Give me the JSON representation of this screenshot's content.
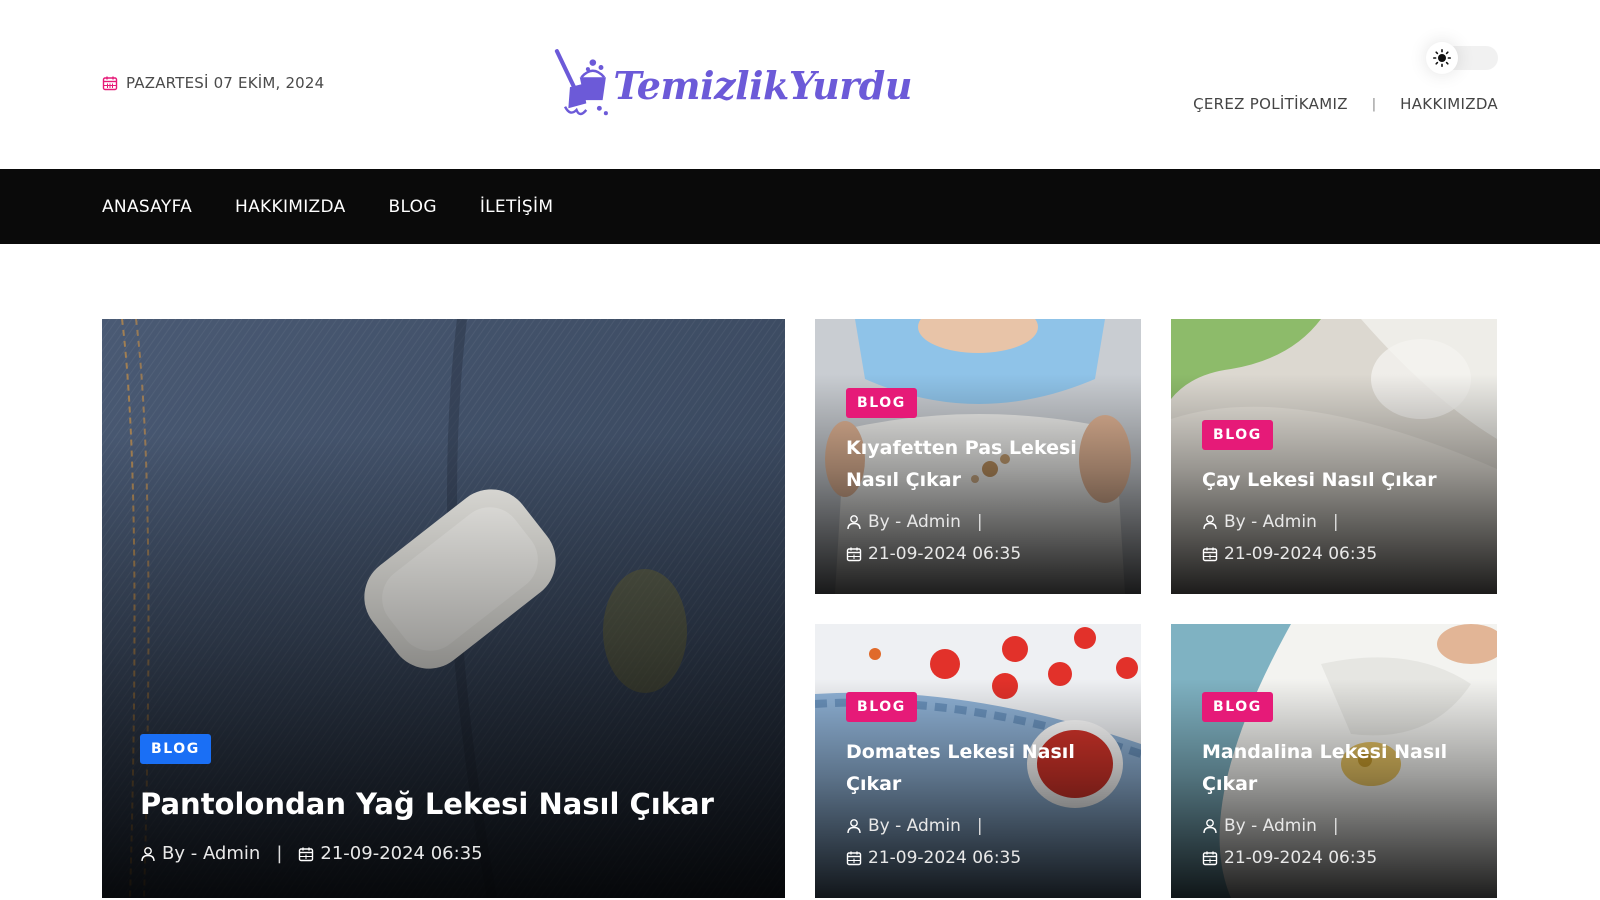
{
  "header": {
    "date": "PAZARTESİ 07 EKİM, 2024",
    "logo_text": "TemizlikYurdu",
    "toplinks": [
      {
        "label": "ÇEREZ POLİTİKAMIZ"
      },
      {
        "label": "HAKKIMIZDA"
      }
    ],
    "toplinks_separator": "|",
    "icons": {
      "date": "calendar-icon",
      "theme": "sun-icon"
    }
  },
  "nav": {
    "items": [
      {
        "label": "ANASAYFA"
      },
      {
        "label": "HAKKIMIZDA"
      },
      {
        "label": "BLOG"
      },
      {
        "label": "İLETİŞİM"
      }
    ]
  },
  "posts": [
    {
      "category": "BLOG",
      "title": "Pantolondan Yağ Lekesi Nasıl Çıkar",
      "author": "By - Admin",
      "date": "21-09-2024 06:35",
      "badge_color": "#1a6ff5"
    },
    {
      "category": "BLOG",
      "title": "Kıyafetten Pas Lekesi Nasıl Çıkar",
      "author": "By - Admin",
      "date": "21-09-2024 06:35",
      "badge_color": "#e61a78"
    },
    {
      "category": "BLOG",
      "title": "Çay Lekesi Nasıl Çıkar",
      "author": "By - Admin",
      "date": "21-09-2024 06:35",
      "badge_color": "#e61a78"
    },
    {
      "category": "BLOG",
      "title": "Domates Lekesi Nasıl Çıkar",
      "author": "By - Admin",
      "date": "21-09-2024 06:35",
      "badge_color": "#e61a78"
    },
    {
      "category": "BLOG",
      "title": "Mandalina Lekesi Nasıl Çıkar",
      "author": "By - Admin",
      "date": "21-09-2024 06:35",
      "badge_color": "#e61a78"
    }
  ],
  "meta_separator": "|",
  "colors": {
    "brand": "#6c5ad8",
    "nav_bg": "#0a0a0a",
    "badge_pink": "#e61a78",
    "badge_blue": "#1a6ff5"
  }
}
